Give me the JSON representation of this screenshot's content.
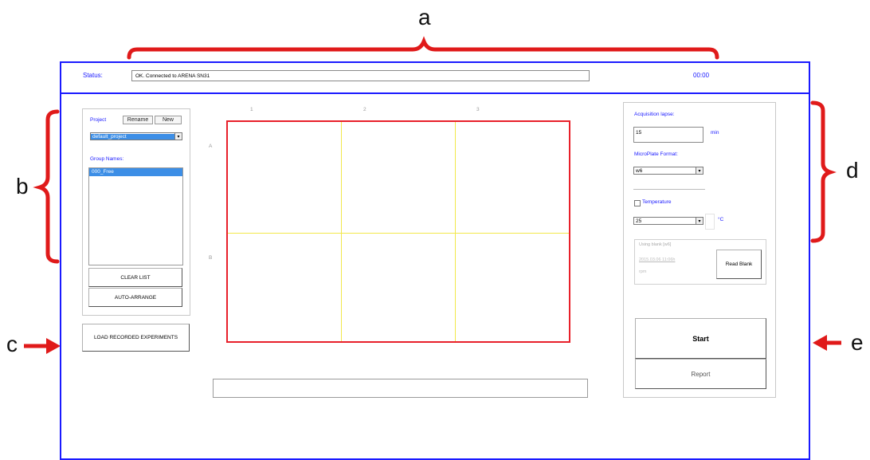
{
  "annotations": {
    "a": "a",
    "b": "b",
    "c": "c",
    "d": "d",
    "e": "e"
  },
  "status_bar": {
    "label": "Status:",
    "message": "OK. Connected to ARENA SN31",
    "time": "00:00"
  },
  "project_panel": {
    "project_label": "Project",
    "rename_button": "Rename",
    "new_button": "New",
    "project_selected": "default_project",
    "group_names_label": "Group Names:",
    "groups": [
      "000_Free"
    ],
    "clear_list_button": "CLEAR LIST",
    "auto_arrange_button": "AUTO-ARRANGE"
  },
  "load_button": "LOAD RECORDED EXPERIMENTS",
  "plate": {
    "columns": [
      "1",
      "2",
      "3"
    ],
    "rows": [
      "A",
      "B"
    ]
  },
  "settings": {
    "acquisition_label": "Acquisition lapse:",
    "acquisition_value": "15",
    "acquisition_unit": "min",
    "format_label": "MicroPlate Format:",
    "format_selected": "w6",
    "temperature_checkbox": "Temperature",
    "temperature_value": "25",
    "temperature_unit": "°C",
    "blank_title": "Using blank [w6]",
    "blank_date": "2015.03.06 11:06h",
    "blank_rpm": "rpm",
    "read_blank_button": "Read Blank",
    "start_button": "Start",
    "report_button": "Report"
  },
  "colors": {
    "window_border": "#1a1aff",
    "annotation_bracket": "#e01a1a",
    "plate_border": "#e8202a",
    "plate_grid": "#f2e84a",
    "label_blue": "#1a1aff",
    "selection": "#3c8ee6"
  }
}
